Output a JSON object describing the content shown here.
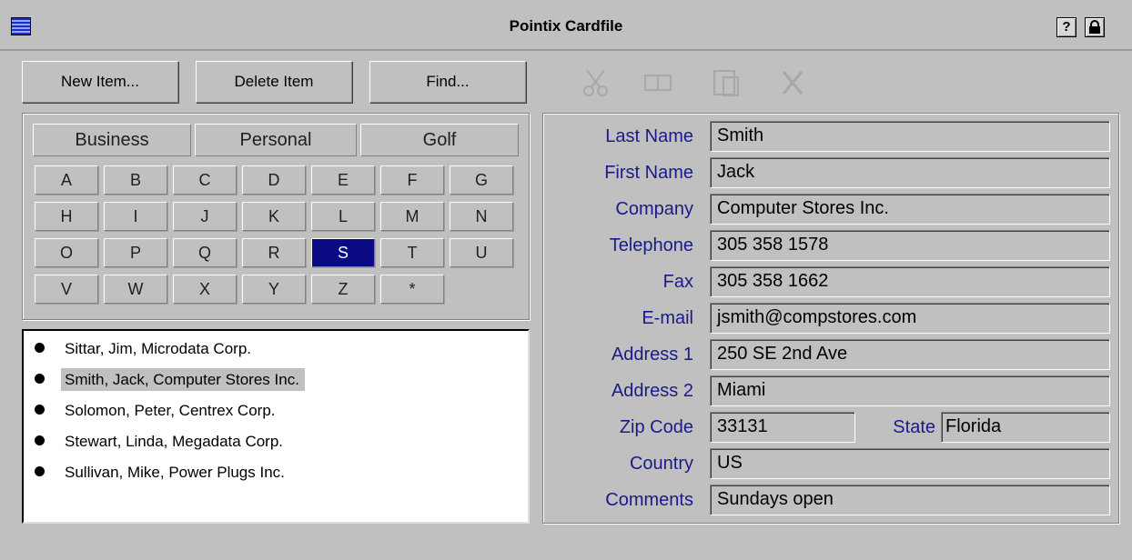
{
  "window": {
    "title": "Pointix Cardfile",
    "help_button": "?",
    "lock_button": "🔒"
  },
  "toolbar": {
    "new_label": "New Item...",
    "delete_label": "Delete Item",
    "find_label": "Find..."
  },
  "edit_tools": [
    {
      "icon": "scissors-icon",
      "glyph": "✂"
    },
    {
      "icon": "copy-icon",
      "glyph": "⧉"
    },
    {
      "icon": "paste-icon",
      "glyph": "❐"
    },
    {
      "icon": "delete-x-icon",
      "glyph": "✗"
    }
  ],
  "tabs": [
    {
      "label": "Business",
      "active": true
    },
    {
      "label": "Personal",
      "active": false
    },
    {
      "label": "Golf",
      "active": false
    }
  ],
  "letters": [
    "A",
    "B",
    "C",
    "D",
    "E",
    "F",
    "G",
    "H",
    "I",
    "J",
    "K",
    "L",
    "M",
    "N",
    "O",
    "P",
    "Q",
    "R",
    "S",
    "T",
    "U",
    "V",
    "W",
    "X",
    "Y",
    "Z",
    "*"
  ],
  "selected_letter": "S",
  "list": [
    {
      "text": "Sittar, Jim, Microdata Corp.",
      "selected": false
    },
    {
      "text": "Smith, Jack, Computer Stores Inc.",
      "selected": true
    },
    {
      "text": "Solomon, Peter, Centrex Corp.",
      "selected": false
    },
    {
      "text": "Stewart, Linda, Megadata Corp.",
      "selected": false
    },
    {
      "text": "Sullivan, Mike, Power Plugs Inc.",
      "selected": false
    }
  ],
  "form": {
    "last_name": {
      "label": "Last Name",
      "value": "Smith"
    },
    "first_name": {
      "label": "First Name",
      "value": "Jack"
    },
    "company": {
      "label": "Company",
      "value": "Computer Stores Inc."
    },
    "telephone": {
      "label": "Telephone",
      "value": "305 358 1578"
    },
    "fax": {
      "label": "Fax",
      "value": "305 358 1662"
    },
    "email": {
      "label": "E-mail",
      "value": "jsmith@compstores.com"
    },
    "address1": {
      "label": "Address 1",
      "value": "250 SE 2nd Ave"
    },
    "address2": {
      "label": "Address 2",
      "value": "Miami"
    },
    "zip": {
      "label": "Zip Code",
      "value": "33131"
    },
    "state": {
      "label": "State",
      "value": "Florida"
    },
    "country": {
      "label": "Country",
      "value": "US"
    },
    "comments": {
      "label": "Comments",
      "value": "Sundays open"
    }
  },
  "colors": {
    "accent": "#0a0a84",
    "label": "#1a1a8c",
    "face": "#c0c0c0"
  }
}
